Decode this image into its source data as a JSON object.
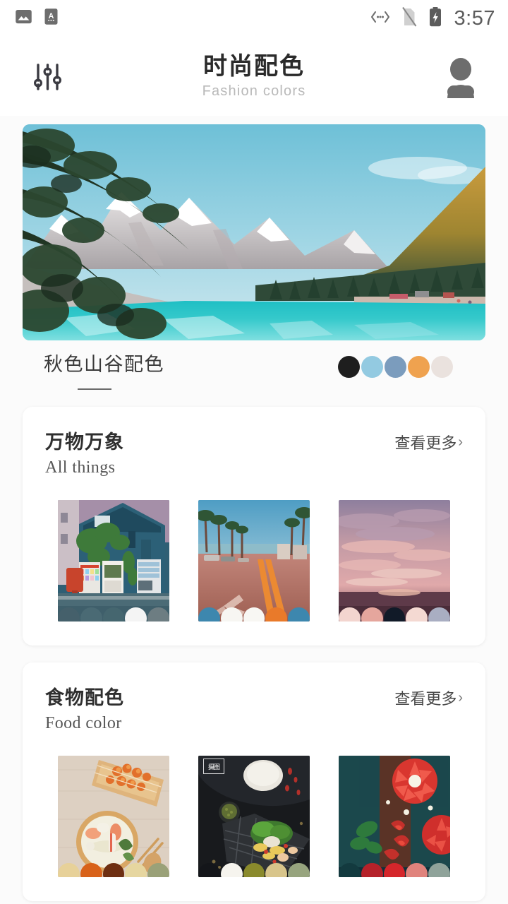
{
  "statusbar": {
    "time": "3:57",
    "left_icons": [
      "image-icon",
      "app-a-icon"
    ],
    "right_icons": [
      "data-transfer-icon",
      "no-sim-icon",
      "battery-charging-icon"
    ]
  },
  "header": {
    "filter_icon": "sliders-icon",
    "title_cn": "时尚配色",
    "title_en": "Fashion colors",
    "avatar_icon": "user-avatar-icon"
  },
  "hero": {
    "image_alt": "mountain-lake-photo",
    "title": "秋色山谷配色",
    "palette": [
      "#1e1e1e",
      "#93cae1",
      "#7b9cbd",
      "#efa24f",
      "#eae2de"
    ]
  },
  "sections": [
    {
      "title_cn": "万物万象",
      "title_en": "All things",
      "more_label": "查看更多",
      "more_chevron": "›",
      "items": [
        {
          "name": "blue-house-vending-machines",
          "palette": [
            "#45606b",
            "#4a6a74",
            "#45666f",
            "#f4f4f4",
            "#6d7d82"
          ],
          "watermark": ""
        },
        {
          "name": "palm-street-beach",
          "palette": [
            "#3d87ae",
            "#f7f6f2",
            "#f8f7f3",
            "#e97a2a",
            "#3d87ae"
          ],
          "watermark": ""
        },
        {
          "name": "pink-sunset-clouds",
          "palette": [
            "#f3d5cf",
            "#e5a69d",
            "#111a28",
            "#f4d9d2",
            "#a9aec2"
          ],
          "watermark": ""
        }
      ]
    },
    {
      "title_cn": "食物配色",
      "title_en": "Food color",
      "more_label": "查看更多",
      "more_chevron": "›",
      "items": [
        {
          "name": "shrimp-noodle-bowl",
          "palette": [
            "#e7d199",
            "#d8621a",
            "#6e2f12",
            "#e6d6a0",
            "#9aa178"
          ],
          "watermark": ""
        },
        {
          "name": "dark-table-salad-rice",
          "palette": [
            "#14161a",
            "#f6f4ee",
            "#8a8a2c",
            "#d8c58b",
            "#97a47e"
          ],
          "watermark": "摄图"
        },
        {
          "name": "strawberry-tarts",
          "palette": [
            "#133a3f",
            "#b5222a",
            "#d5262b",
            "#e0837c",
            "#8fa39a"
          ],
          "watermark": ""
        }
      ]
    }
  ]
}
